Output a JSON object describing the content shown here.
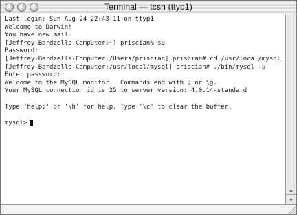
{
  "window": {
    "title": "Terminal — tcsh (ttyp1)"
  },
  "terminal": {
    "lines": [
      "Last login: Sun Aug 24 22:43:11 on ttyp1",
      "Welcome to Darwin!",
      "You have new mail.",
      "[Jeffrey-Bardzells-Computer:~] priscian% su",
      "Password:",
      "[Jeffrey-Bardzells-Computer:/Users/priscian] priscian# cd /usr/local/mysql/",
      "[Jeffrey-Bardzells-Computer:/usr/local/mysql] priscian# ./bin/mysql -u",
      "Enter password:",
      "Welcome to the MySQL monitor.  Commands end with ; or \\g.",
      "Your MySQL connection id is 25 to server version: 4.0.14-standard",
      "",
      "Type 'help;' or '\\h' for help. Type '\\c' to clear the buffer.",
      ""
    ],
    "prompt": "mysql>"
  },
  "icons": {
    "close": "close-button-icon",
    "minimize": "minimize-button-icon",
    "zoom": "zoom-button-icon",
    "scroll_up": "scroll-up-arrow-icon",
    "scroll_down": "scroll-down-arrow-icon",
    "resize": "resize-grip-icon"
  }
}
